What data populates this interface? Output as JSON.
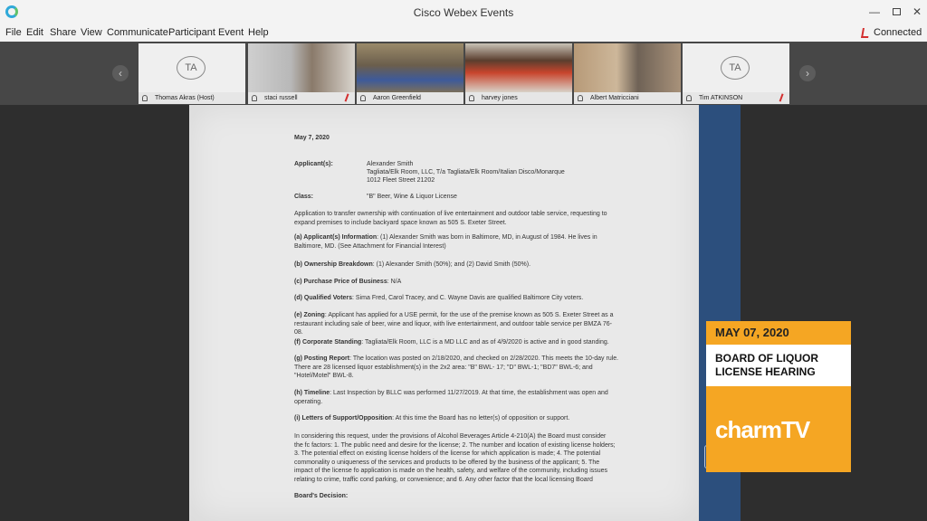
{
  "window": {
    "title": "Cisco Webex Events"
  },
  "menu": [
    "File",
    "Edit",
    "Share",
    "View",
    "Communicate",
    "Participant",
    "Event",
    "Help"
  ],
  "status": {
    "label": "Connected"
  },
  "participants": [
    {
      "name": "Thomas Akras (Host)",
      "initials": "TA"
    },
    {
      "name": "staci russell"
    },
    {
      "name": "Aaron Greenfield"
    },
    {
      "name": "harvey jones"
    },
    {
      "name": "Albert Matricciani"
    },
    {
      "name": "Tim ATKINSON",
      "initials": "TA"
    }
  ],
  "document": {
    "date": "May 7, 2020",
    "applicant_label": "Applicant(s):",
    "applicant_lines": [
      "Alexander Smith",
      "Tagliata/Elk Room, LLC, T/a Tagliata/Elk Room/Italian Disco/Monarque",
      "1012 Fleet Street 21202"
    ],
    "class_label": "Class:",
    "class_value": "\"B\" Beer, Wine & Liquor License",
    "intro": "Application to transfer ownership with continuation of live entertainment and outdoor table service, requesting to expand premises to include backyard space known as 505 S. Exeter Street.",
    "items": [
      {
        "label": "(a) Applicant(s) Information",
        "text": ": (1) Alexander Smith was born in Baltimore, MD, in August of 1984. He lives in Baltimore, MD. (See Attachment for Financial Interest)"
      },
      {
        "label": "(b) Ownership Breakdown",
        "text": ": (1) Alexander Smith (50%); and (2) David Smith (50%)."
      },
      {
        "label": "(c) Purchase Price of Business",
        "text": ": N/A"
      },
      {
        "label": "(d) Qualified Voters",
        "text": ": Sima Fred, Carol Tracey, and C. Wayne Davis are qualified Baltimore City voters."
      },
      {
        "label": "(e) Zoning",
        "text": ": Applicant has applied for a USE permit, for the use of the premise known as 505 S. Exeter Street as a restaurant including sale of beer, wine and liquor, with live entertainment, and outdoor table service per BMZA 76-08."
      },
      {
        "label": "(f) Corporate Standing",
        "text": ": Tagliata/Elk Room, LLC is a MD LLC and as of 4/9/2020 is active and in good standing."
      },
      {
        "label": "(g) Posting Report",
        "text": ": The location was posted on 2/18/2020, and checked on 2/28/2020. This meets the 10-day rule. There are 28 licensed liquor establishment(s) in the 2x2 area: \"B\" BWL- 17; \"D\" BWL-1; \"BD7\" BWL-6; and \"Hotel/Motel\" BWL-8."
      },
      {
        "label": "(h) Timeline",
        "text": ": Last Inspection by BLLC was performed 11/27/2019. At that time, the establishment was open and operating."
      },
      {
        "label": "(i) Letters of Support/Opposition",
        "text": ": At this time the Board has no letter(s) of opposition or support."
      }
    ],
    "considering": "In considering this request, under the provisions of Alcohol Beverages Article 4-210(A) the Board must consider the fc factors: 1. The public need and desire for the license; 2. The number and location of existing license holders; 3. The potential effect on existing license holders of the license for which application is made; 4. The potential commonality o uniqueness of the services and products to be offered by the business of the applicant; 5. The impact of the license fo application is made on the health, safety, and welfare of the community, including issues relating to crime, traffic cond parking, or convenience; and 6. Any other factor that the local licensing Board considers necessary.",
    "decision": "Board's Decision:"
  },
  "overlay": {
    "date": "MAY 07, 2020",
    "title_line1": "BOARD OF LIQUOR",
    "title_line2": "LICENSE HEARING",
    "brand": "charm",
    "brand_suffix": "TV"
  },
  "colors": {
    "accent": "#f5a623",
    "active_tile": "#31a9dc",
    "doc_side": "#2c4f7d",
    "mute": "#d32f2f"
  }
}
